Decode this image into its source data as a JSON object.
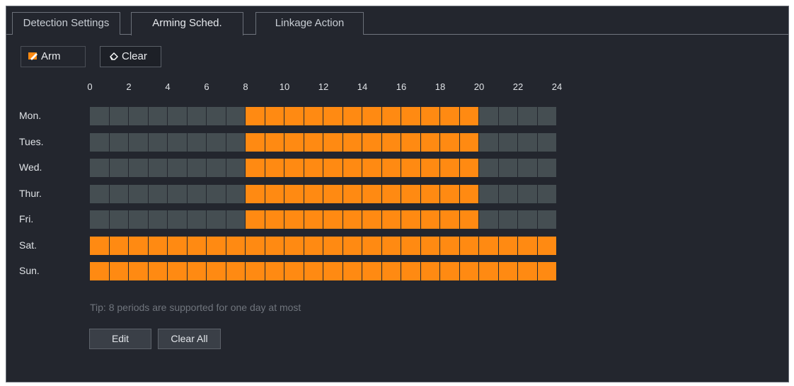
{
  "tabs": [
    "Detection Settings",
    "Arming Sched.",
    "Linkage Action"
  ],
  "active_tab": 1,
  "toolbar": {
    "arm_label": "Arm",
    "clear_label": "Clear",
    "arm_icon": "pencil-icon",
    "clear_icon": "eraser-icon"
  },
  "hour_labels": [
    "0",
    "2",
    "4",
    "6",
    "8",
    "10",
    "12",
    "14",
    "16",
    "18",
    "20",
    "22",
    "24"
  ],
  "days": [
    {
      "label": "Mon.",
      "armed": [
        [
          8,
          20
        ]
      ]
    },
    {
      "label": "Tues.",
      "armed": [
        [
          8,
          20
        ]
      ]
    },
    {
      "label": "Wed.",
      "armed": [
        [
          8,
          20
        ]
      ]
    },
    {
      "label": "Thur.",
      "armed": [
        [
          8,
          20
        ]
      ]
    },
    {
      "label": "Fri.",
      "armed": [
        [
          8,
          20
        ]
      ]
    },
    {
      "label": "Sat.",
      "armed": [
        [
          0,
          24
        ]
      ]
    },
    {
      "label": "Sun.",
      "armed": [
        [
          0,
          24
        ]
      ]
    }
  ],
  "tip": "Tip: 8 periods are supported for one day at most",
  "buttons": {
    "edit": "Edit",
    "clear_all": "Clear All"
  },
  "colors": {
    "armed": "#ff8a12",
    "unarmed": "#454e52",
    "background": "#23262e"
  }
}
